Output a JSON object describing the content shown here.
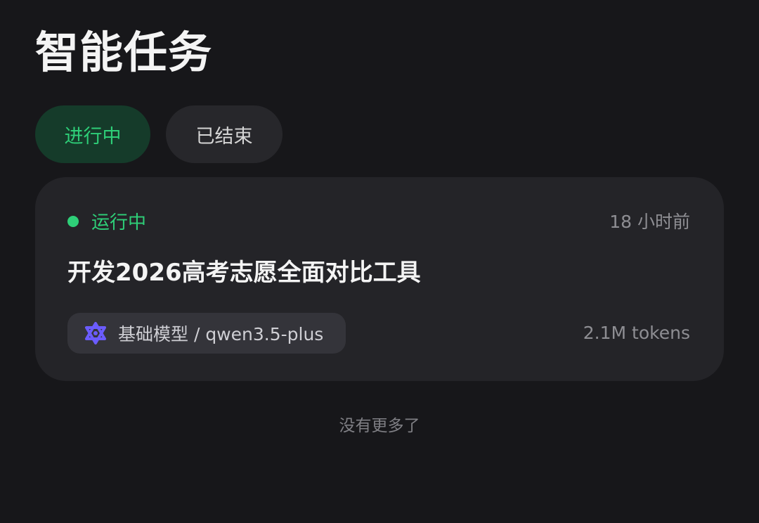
{
  "header": {
    "title": "智能任务"
  },
  "tabs": [
    {
      "label": "进行中",
      "active": true
    },
    {
      "label": "已结束",
      "active": false
    }
  ],
  "task": {
    "status": "运行中",
    "time_ago": "18 小时前",
    "title": "开发2026高考志愿全面对比工具",
    "model_icon": "qwen-logo-icon",
    "model_label": "基础模型 / qwen3.5-plus",
    "tokens": "2.1M tokens"
  },
  "footer": {
    "no_more": "没有更多了"
  },
  "colors": {
    "background": "#17171a",
    "card": "#242428",
    "accent_green": "#2ecf78",
    "active_tab_bg": "#153b2a",
    "model_icon": "#6b5cff"
  }
}
